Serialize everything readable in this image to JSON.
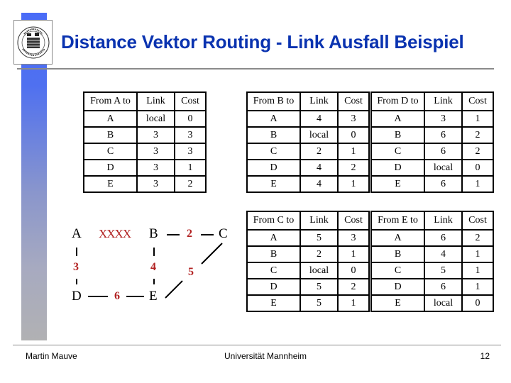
{
  "header": {
    "title": "Distance Vektor Routing - Link Ausfall Beispiel",
    "logo": "university-seal-icon"
  },
  "colors": {
    "title": "#0a33b0",
    "link_label": "#b22222",
    "rule": "#8a8a8a",
    "side_bar_top": "#4a6cf7",
    "side_bar_bottom": "#b1b1b3"
  },
  "column_headers": {
    "link": "Link",
    "cost": "Cost"
  },
  "tables": {
    "A": {
      "header": "From A to",
      "rows": [
        {
          "dest": "A",
          "link": "local",
          "cost": "0"
        },
        {
          "dest": "B",
          "link": "3",
          "cost": "3"
        },
        {
          "dest": "C",
          "link": "3",
          "cost": "3"
        },
        {
          "dest": "D",
          "link": "3",
          "cost": "1"
        },
        {
          "dest": "E",
          "link": "3",
          "cost": "2"
        }
      ]
    },
    "B": {
      "header": "From B to",
      "rows": [
        {
          "dest": "A",
          "link": "4",
          "cost": "3"
        },
        {
          "dest": "B",
          "link": "local",
          "cost": "0"
        },
        {
          "dest": "C",
          "link": "2",
          "cost": "1"
        },
        {
          "dest": "D",
          "link": "4",
          "cost": "2"
        },
        {
          "dest": "E",
          "link": "4",
          "cost": "1"
        }
      ]
    },
    "D": {
      "header": "From D to",
      "rows": [
        {
          "dest": "A",
          "link": "3",
          "cost": "1"
        },
        {
          "dest": "B",
          "link": "6",
          "cost": "2"
        },
        {
          "dest": "C",
          "link": "6",
          "cost": "2"
        },
        {
          "dest": "D",
          "link": "local",
          "cost": "0"
        },
        {
          "dest": "E",
          "link": "6",
          "cost": "1"
        }
      ]
    },
    "C": {
      "header": "From C to",
      "rows": [
        {
          "dest": "A",
          "link": "5",
          "cost": "3"
        },
        {
          "dest": "B",
          "link": "2",
          "cost": "1"
        },
        {
          "dest": "C",
          "link": "local",
          "cost": "0"
        },
        {
          "dest": "D",
          "link": "5",
          "cost": "2"
        },
        {
          "dest": "E",
          "link": "5",
          "cost": "1"
        }
      ]
    },
    "E": {
      "header": "From E to",
      "rows": [
        {
          "dest": "A",
          "link": "6",
          "cost": "2"
        },
        {
          "dest": "B",
          "link": "4",
          "cost": "1"
        },
        {
          "dest": "C",
          "link": "5",
          "cost": "1"
        },
        {
          "dest": "D",
          "link": "6",
          "cost": "1"
        },
        {
          "dest": "E",
          "link": "local",
          "cost": "0"
        }
      ]
    }
  },
  "graph": {
    "nodes": {
      "A": "A",
      "B": "B",
      "C": "C",
      "D": "D",
      "E": "E"
    },
    "links": {
      "failed_A_B": "XXXX",
      "B_C": "2",
      "A_D": "3",
      "B_E": "4",
      "C_E": "5",
      "D_E": "6"
    }
  },
  "footer": {
    "author": "Martin Mauve",
    "institution": "Universität Mannheim",
    "page_number": "12"
  }
}
